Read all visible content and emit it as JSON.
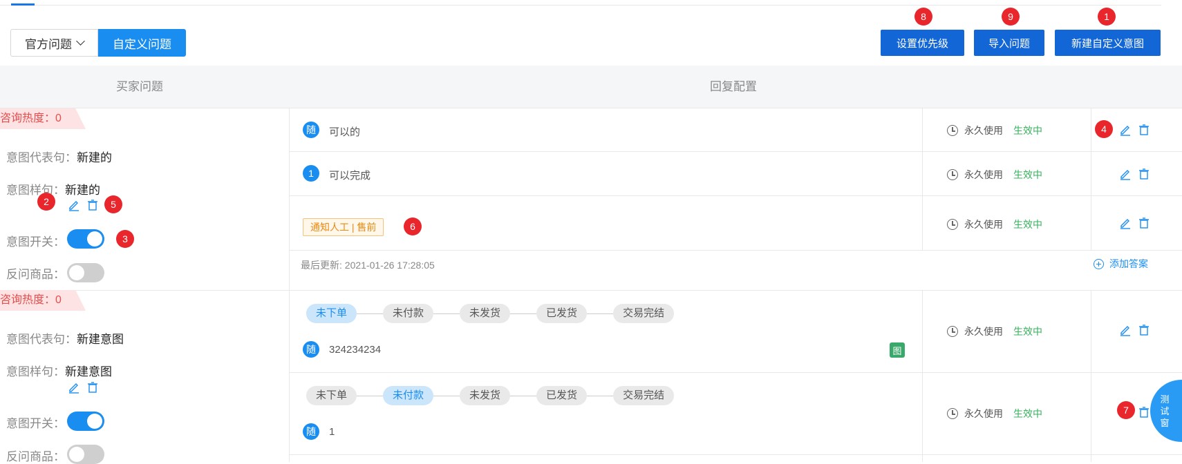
{
  "toolbar": {
    "official_label": "官方问题",
    "custom_label": "自定义问题",
    "set_priority": "设置优先级",
    "import_questions": "导入问题",
    "new_intent": "新建自定义意图"
  },
  "badges": [
    "1",
    "2",
    "3",
    "4",
    "5",
    "6",
    "7",
    "8",
    "9"
  ],
  "table": {
    "col_buyer": "买家问题",
    "col_reply": "回复配置"
  },
  "intents": [
    {
      "hot_label": "咨询热度：0",
      "rep_label": "意图代表句：",
      "rep_value": "新建的",
      "sample_label": "意图样句：",
      "sample_value": "新建的",
      "switch_label": "意图开关：",
      "switch_on": true,
      "product_label": "反问商品：",
      "product_on": false,
      "replies": [
        {
          "marker": "随",
          "text": "可以的",
          "validity": "永久使用",
          "status": "生效中"
        },
        {
          "marker": "1",
          "text": "可以完成",
          "validity": "永久使用",
          "status": "生效中"
        },
        {
          "tag": "通知人工 | 售前",
          "validity": "永久使用",
          "status": "生效中"
        }
      ],
      "last_update": "最后更新: 2021-01-26 17:28:05",
      "add_answer": "添加答案"
    },
    {
      "hot_label": "咨询热度：0",
      "rep_label": "意图代表句：",
      "rep_value": "新建意图",
      "sample_label": "意图样句：",
      "sample_value": "新建意图",
      "switch_label": "意图开关：",
      "switch_on": true,
      "product_label": "反问商品：",
      "product_on": false,
      "replies": [
        {
          "steps": [
            "未下单",
            "未付款",
            "未发货",
            "已发货",
            "交易完结"
          ],
          "active_step": "未下单",
          "marker": "随",
          "text": "324234234",
          "image_icon": "图",
          "validity": "永久使用",
          "status": "生效中"
        },
        {
          "steps": [
            "未下单",
            "未付款",
            "未发货",
            "已发货",
            "交易完结"
          ],
          "active_step": "未付款",
          "marker": "随",
          "text": "1",
          "validity": "永久使用",
          "status": "生效中"
        }
      ]
    }
  ],
  "test_window": [
    "测",
    "试",
    "窗"
  ],
  "colors": {
    "primary": "#1366d6",
    "accent": "#1a8df0",
    "badge": "#e8262c",
    "active": "#36b15c",
    "hot": "#e84d4d"
  }
}
